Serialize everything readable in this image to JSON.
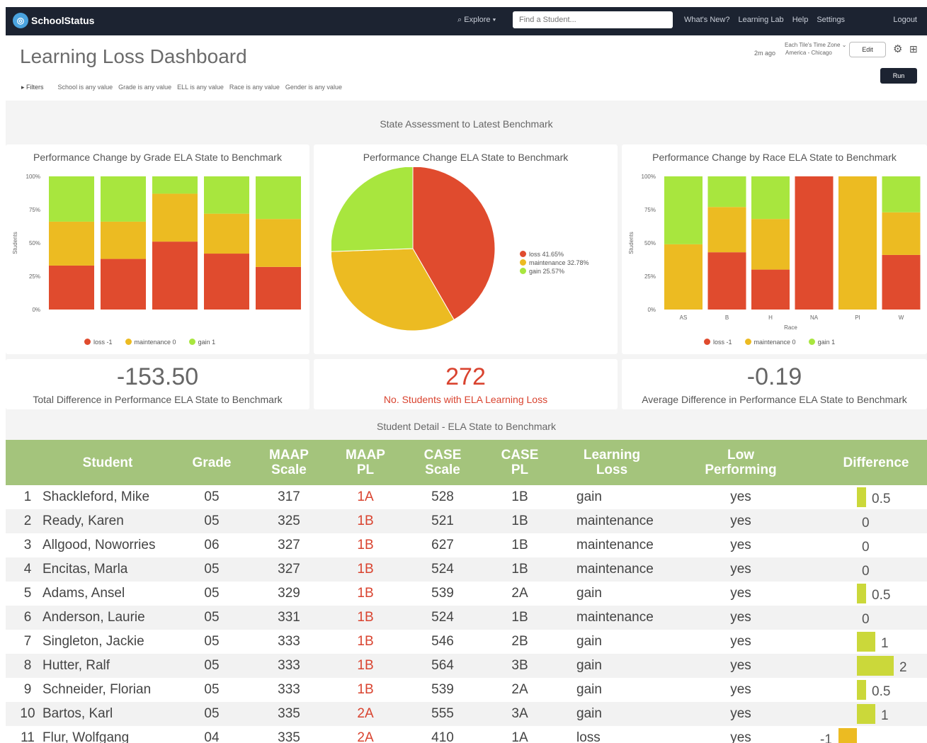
{
  "nav": {
    "logo": "SchoolStatus",
    "explore": "Explore",
    "search_placeholder": "Find a Student...",
    "links": [
      "What's New?",
      "Learning Lab",
      "Help",
      "Settings"
    ],
    "logout": "Logout"
  },
  "header": {
    "title": "Learning Loss Dashboard",
    "updated": "2m ago",
    "tz_label": "Each Tile's Time Zone",
    "tz_value": "America - Chicago",
    "edit": "Edit",
    "run": "Run",
    "filters_label": "Filters",
    "filters": [
      "School is any value",
      "Grade is any value",
      "ELL is any value",
      "Race is any value",
      "Gender is any value"
    ]
  },
  "section1_title": "State Assessment to Latest Benchmark",
  "colors": {
    "loss": "#e04b2e",
    "maintenance": "#ecbb22",
    "gain": "#a8e63e",
    "header_green": "#a4c47c",
    "diff_bar": "#cbd83a"
  },
  "legend": {
    "loss": "loss -1",
    "maintenance": "maintenance 0",
    "gain": "gain 1",
    "race_axis": "Race",
    "y_axis": "Students"
  },
  "chart_data": [
    {
      "type": "bar",
      "title": "Performance Change by Grade ELA State to Benchmark",
      "ylabel": "Students",
      "ylim": [
        0,
        100
      ],
      "yticks": [
        "100%",
        "75%",
        "50%",
        "25%",
        "0%"
      ],
      "categories": [
        "",
        "",
        "",
        "",
        ""
      ],
      "stacked": true,
      "series": [
        {
          "name": "loss -1",
          "values": [
            33,
            38,
            51,
            42,
            32
          ]
        },
        {
          "name": "maintenance 0",
          "values": [
            33,
            28,
            36,
            30,
            36
          ]
        },
        {
          "name": "gain 1",
          "values": [
            34,
            34,
            13,
            28,
            32
          ]
        }
      ]
    },
    {
      "type": "pie",
      "title": "Performance Change ELA State to Benchmark",
      "slices": [
        {
          "name": "loss",
          "value": 41.65,
          "label": "loss 41.65%"
        },
        {
          "name": "maintenance",
          "value": 32.78,
          "label": "maintenance 32.78%"
        },
        {
          "name": "gain",
          "value": 25.57,
          "label": "gain 25.57%"
        }
      ]
    },
    {
      "type": "bar",
      "title": "Performance Change by Race ELA State to Benchmark",
      "xlabel": "Race",
      "ylabel": "Students",
      "ylim": [
        0,
        100
      ],
      "yticks": [
        "100%",
        "75%",
        "50%",
        "25%",
        "0%"
      ],
      "categories": [
        "AS",
        "B",
        "H",
        "NA",
        "PI",
        "W"
      ],
      "stacked": true,
      "series": [
        {
          "name": "loss -1",
          "values": [
            0,
            43,
            30,
            100,
            0,
            41
          ]
        },
        {
          "name": "maintenance 0",
          "values": [
            49,
            34,
            38,
            0,
            100,
            32
          ]
        },
        {
          "name": "gain 1",
          "values": [
            51,
            23,
            32,
            0,
            0,
            27
          ]
        }
      ]
    }
  ],
  "stats": [
    {
      "value": "-153.50",
      "label": "Total Difference in Performance ELA State to Benchmark"
    },
    {
      "value": "272",
      "label": "No. Students with ELA Learning Loss"
    },
    {
      "value": "-0.19",
      "label": "Average Difference in Performance ELA State to Benchmark"
    }
  ],
  "table_title_prefix": "Student Detail",
  "table_title_suffix": "ELA State to Benchmark",
  "table": {
    "headers": {
      "student": "Student",
      "grade": "Grade",
      "maap_scale": [
        "MAAP",
        "Scale"
      ],
      "maap_pl": [
        "MAAP",
        "PL"
      ],
      "case_scale": [
        "CASE",
        "Scale"
      ],
      "case_pl": [
        "CASE",
        "PL"
      ],
      "learning_loss": [
        "Learning",
        "Loss"
      ],
      "low_performing": [
        "Low",
        "Performing"
      ],
      "difference": "Difference"
    },
    "rows": [
      {
        "n": "1",
        "student": "Shackleford, Mike",
        "grade": "05",
        "maap_scale": "317",
        "maap_pl": "1A",
        "case_scale": "528",
        "case_pl": "1B",
        "loss": "gain",
        "low": "yes",
        "diff": 0.5,
        "diff_label": "0.5"
      },
      {
        "n": "2",
        "student": "Ready, Karen",
        "grade": "05",
        "maap_scale": "325",
        "maap_pl": "1B",
        "case_scale": "521",
        "case_pl": "1B",
        "loss": "maintenance",
        "low": "yes",
        "diff": 0,
        "diff_label": "0"
      },
      {
        "n": "3",
        "student": "Allgood, Noworries",
        "grade": "06",
        "maap_scale": "327",
        "maap_pl": "1B",
        "case_scale": "627",
        "case_pl": "1B",
        "loss": "maintenance",
        "low": "yes",
        "diff": 0,
        "diff_label": "0"
      },
      {
        "n": "4",
        "student": "Encitas, Marla",
        "grade": "05",
        "maap_scale": "327",
        "maap_pl": "1B",
        "case_scale": "524",
        "case_pl": "1B",
        "loss": "maintenance",
        "low": "yes",
        "diff": 0,
        "diff_label": "0"
      },
      {
        "n": "5",
        "student": "Adams, Ansel",
        "grade": "05",
        "maap_scale": "329",
        "maap_pl": "1B",
        "case_scale": "539",
        "case_pl": "2A",
        "loss": "gain",
        "low": "yes",
        "diff": 0.5,
        "diff_label": "0.5"
      },
      {
        "n": "6",
        "student": "Anderson, Laurie",
        "grade": "05",
        "maap_scale": "331",
        "maap_pl": "1B",
        "case_scale": "524",
        "case_pl": "1B",
        "loss": "maintenance",
        "low": "yes",
        "diff": 0,
        "diff_label": "0"
      },
      {
        "n": "7",
        "student": "Singleton, Jackie",
        "grade": "05",
        "maap_scale": "333",
        "maap_pl": "1B",
        "case_scale": "546",
        "case_pl": "2B",
        "loss": "gain",
        "low": "yes",
        "diff": 1,
        "diff_label": "1"
      },
      {
        "n": "8",
        "student": "Hutter, Ralf",
        "grade": "05",
        "maap_scale": "333",
        "maap_pl": "1B",
        "case_scale": "564",
        "case_pl": "3B",
        "loss": "gain",
        "low": "yes",
        "diff": 2,
        "diff_label": "2"
      },
      {
        "n": "9",
        "student": "Schneider, Florian",
        "grade": "05",
        "maap_scale": "333",
        "maap_pl": "1B",
        "case_scale": "539",
        "case_pl": "2A",
        "loss": "gain",
        "low": "yes",
        "diff": 0.5,
        "diff_label": "0.5"
      },
      {
        "n": "10",
        "student": "Bartos, Karl",
        "grade": "05",
        "maap_scale": "335",
        "maap_pl": "2A",
        "case_scale": "555",
        "case_pl": "3A",
        "loss": "gain",
        "low": "yes",
        "diff": 1,
        "diff_label": "1"
      },
      {
        "n": "11",
        "student": "Flur, Wolfgang",
        "grade": "04",
        "maap_scale": "335",
        "maap_pl": "2A",
        "case_scale": "410",
        "case_pl": "1A",
        "loss": "loss",
        "low": "yes",
        "diff": -1,
        "diff_label": "-1"
      }
    ]
  }
}
